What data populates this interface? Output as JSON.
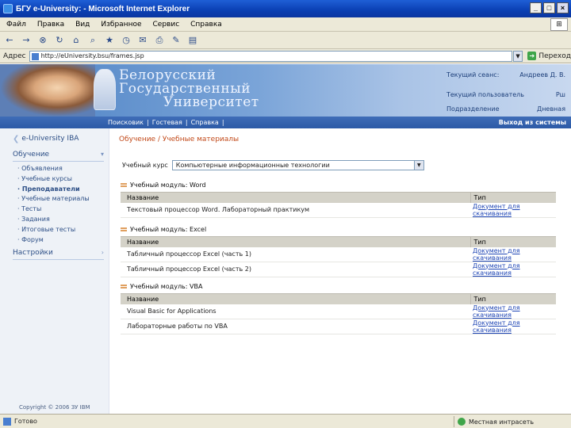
{
  "window": {
    "title": "БГУ e-University: - Microsoft Internet Explorer",
    "controls": [
      "_",
      "□",
      "×"
    ]
  },
  "menubar": {
    "items": [
      "Файл",
      "Правка",
      "Вид",
      "Избранное",
      "Сервис",
      "Справка"
    ]
  },
  "address": {
    "label": "Адрес",
    "url": "http://eUniversity.bsu/frames.jsp",
    "go_label": "Переход"
  },
  "header": {
    "university_lines": [
      "Белорусский",
      "Государственный",
      "Университет"
    ],
    "current_user_label": "Текущий сеанс:",
    "current_user_value": "Андреев Д. В.",
    "rows": [
      {
        "label": "Текущий пользователь",
        "value": "Рш"
      },
      {
        "label": "Подразделение",
        "value": "Дневная"
      }
    ]
  },
  "nav": {
    "links": [
      "Поисковик",
      "|",
      "Гостевая",
      "|",
      "Справка",
      "|"
    ],
    "exit_label": "Выход из системы"
  },
  "sidebar": {
    "brand": "e-University IBA",
    "section_title": "Обучение",
    "items": [
      {
        "label": "Объявления",
        "bold": false
      },
      {
        "label": "Учебные курсы",
        "bold": false
      },
      {
        "label": "Преподаватели",
        "bold": true
      },
      {
        "label": "Учебные материалы",
        "bold": false
      },
      {
        "label": "Тесты",
        "bold": false
      },
      {
        "label": "Задания",
        "bold": false
      },
      {
        "label": "Итоговые тесты",
        "bold": false
      },
      {
        "label": "Форум",
        "bold": false
      }
    ],
    "settings_title": "Настройки",
    "copyright": "Copyright © 2006 ЗУ IBM"
  },
  "main": {
    "breadcrumb": "Обучение / Учебные материалы",
    "course_label": "Учебный курс",
    "course_value": "Компьютерные информационные технологии",
    "columns": {
      "name": "Название",
      "type": "Тип"
    },
    "modules": [
      {
        "title": "Учебный модуль: Word",
        "rows": [
          {
            "name": "Текстовый процессор Word. Лабораторный практикум",
            "type": "Документ для скачивания"
          }
        ]
      },
      {
        "title": "Учебный модуль: Excel",
        "rows": [
          {
            "name": "Табличный процессор Excel (часть 1)",
            "type": "Документ для скачивания"
          },
          {
            "name": "Табличный процессор Excel (часть 2)",
            "type": "Документ для скачивания"
          }
        ]
      },
      {
        "title": "Учебный модуль: VBA",
        "rows": [
          {
            "name": "Visual Basic for Applications",
            "type": "Документ для скачивания"
          },
          {
            "name": "Лабораторные работы по VBA",
            "type": "Документ для скачивания"
          }
        ]
      }
    ]
  },
  "status": {
    "text": "Готово",
    "zone": "Местная интрасеть"
  }
}
